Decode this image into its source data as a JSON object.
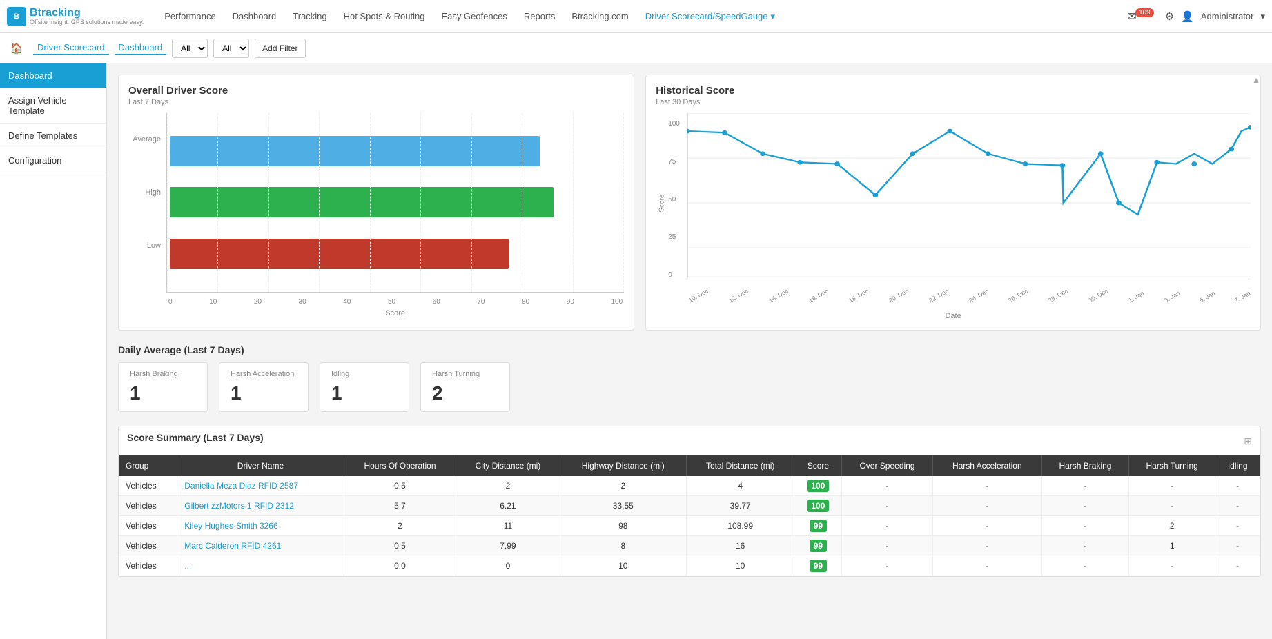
{
  "brand": {
    "name": "Btracking",
    "tagline": "Offsite Insight. GPS solutions made easy."
  },
  "nav": {
    "items": [
      {
        "label": "Performance",
        "active": false
      },
      {
        "label": "Dashboard",
        "active": false
      },
      {
        "label": "Tracking",
        "active": false
      },
      {
        "label": "Hot Spots & Routing",
        "active": false
      },
      {
        "label": "Easy Geofences",
        "active": false
      },
      {
        "label": "Reports",
        "active": false
      },
      {
        "label": "Btracking.com",
        "active": false
      },
      {
        "label": "Driver Scorecard/SpeedGauge",
        "active": true,
        "dropdown": true
      }
    ],
    "notifications": "109",
    "admin_label": "Administrator"
  },
  "subnav": {
    "breadcrumb": "Driver Scorecard",
    "tab_active": "Dashboard",
    "filter1_value": "All",
    "filter2_value": "All",
    "add_filter_label": "Add Filter"
  },
  "sidebar": {
    "items": [
      {
        "label": "Dashboard",
        "active": true
      },
      {
        "label": "Assign Vehicle Template",
        "active": false
      },
      {
        "label": "Define Templates",
        "active": false
      },
      {
        "label": "Configuration",
        "active": false
      }
    ]
  },
  "overall_chart": {
    "title": "Overall Driver Score",
    "subtitle": "Last 7 Days",
    "bars": [
      {
        "label": "Average",
        "value": 82,
        "color": "blue",
        "pct": 82
      },
      {
        "label": "High",
        "value": 85,
        "color": "green",
        "pct": 85
      },
      {
        "label": "Low",
        "value": 75,
        "color": "red",
        "pct": 75
      }
    ],
    "x_labels": [
      "0",
      "10",
      "20",
      "30",
      "40",
      "50",
      "60",
      "70",
      "80",
      "90",
      "100"
    ],
    "x_title": "Score"
  },
  "historical_chart": {
    "title": "Historical Score",
    "subtitle": "Last 30 Days",
    "y_labels": [
      "0",
      "25",
      "50",
      "75",
      "100"
    ],
    "x_labels": [
      "10. Dec",
      "12. Dec",
      "14. Dec",
      "16. Dec",
      "18. Dec",
      "20. Dec",
      "22. Dec",
      "24. Dec",
      "26. Dec",
      "28. Dec",
      "30. Dec",
      "1. Jan",
      "3. Jan",
      "5. Jan",
      "7. Jan"
    ],
    "x_title": "Date",
    "y_title": "Score"
  },
  "daily_average": {
    "title": "Daily Average (Last 7 Days)",
    "cards": [
      {
        "label": "Harsh Braking",
        "value": "1"
      },
      {
        "label": "Harsh Acceleration",
        "value": "1"
      },
      {
        "label": "Idling",
        "value": "1"
      },
      {
        "label": "Harsh Turning",
        "value": "2"
      }
    ]
  },
  "score_summary": {
    "title": "Score Summary (Last 7 Days)",
    "columns": [
      "Group",
      "Driver Name",
      "Hours Of Operation",
      "City Distance (mi)",
      "Highway Distance (mi)",
      "Total Distance (mi)",
      "Score",
      "Over Speeding",
      "Harsh Acceleration",
      "Harsh Braking",
      "Harsh Turning",
      "Idling"
    ],
    "rows": [
      {
        "group": "Vehicles",
        "driver": "Daniella Meza Diaz RFID 2587",
        "hours": "0.5",
        "city": "2",
        "highway": "2",
        "total": "4",
        "score": "100",
        "over_speeding": "-",
        "harsh_acc": "-",
        "harsh_brk": "-",
        "harsh_turn": "-",
        "idling": "-"
      },
      {
        "group": "Vehicles",
        "driver": "Gilbert zzMotors 1 RFID 2312",
        "hours": "5.7",
        "city": "6.21",
        "highway": "33.55",
        "total": "39.77",
        "score": "100",
        "over_speeding": "-",
        "harsh_acc": "-",
        "harsh_brk": "-",
        "harsh_turn": "-",
        "idling": "-"
      },
      {
        "group": "Vehicles",
        "driver": "Kiley Hughes-Smith 3266",
        "hours": "2",
        "city": "11",
        "highway": "98",
        "total": "108.99",
        "score": "99",
        "over_speeding": "-",
        "harsh_acc": "-",
        "harsh_brk": "-",
        "harsh_turn": "2",
        "idling": "-"
      },
      {
        "group": "Vehicles",
        "driver": "Marc Calderon RFID 4261",
        "hours": "0.5",
        "city": "7.99",
        "highway": "8",
        "total": "16",
        "score": "99",
        "over_speeding": "-",
        "harsh_acc": "-",
        "harsh_brk": "-",
        "harsh_turn": "1",
        "idling": "-"
      },
      {
        "group": "Vehicles",
        "driver": "...",
        "hours": "0.0",
        "city": "0",
        "highway": "10",
        "total": "10",
        "score": "99",
        "over_speeding": "-",
        "harsh_acc": "-",
        "harsh_brk": "-",
        "harsh_turn": "-",
        "idling": "-"
      }
    ]
  }
}
